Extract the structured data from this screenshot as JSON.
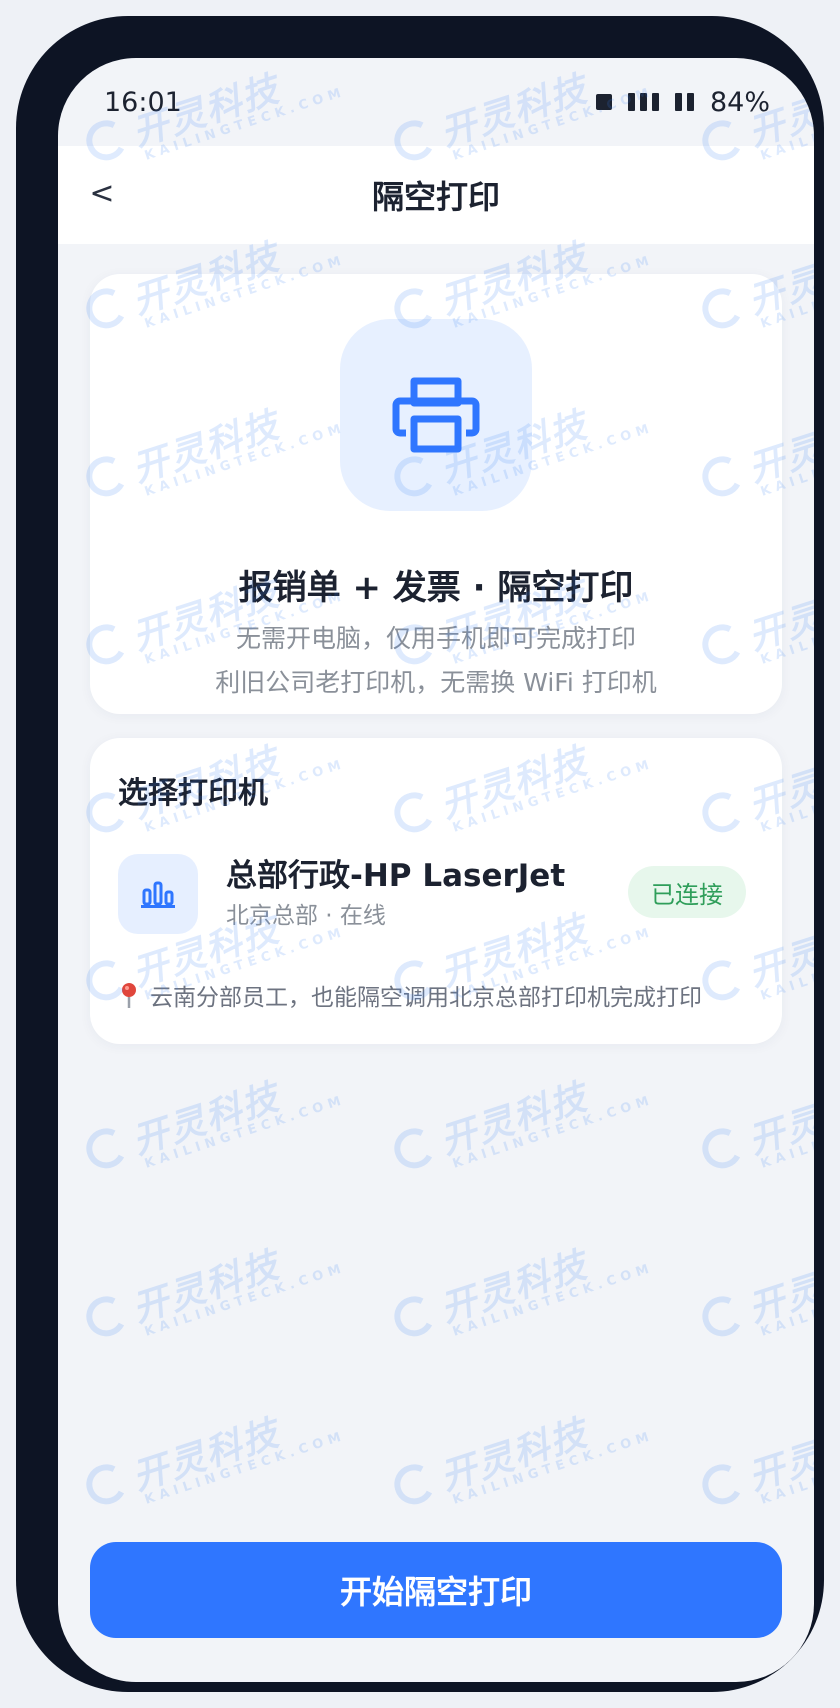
{
  "status_bar": {
    "time": "16:01",
    "battery": "84%"
  },
  "nav": {
    "back_label": "<",
    "title": "隔空打印"
  },
  "hero": {
    "icon": "printer-icon",
    "title": "报销单 + 发票 · 隔空打印",
    "subtitle_1": "无需开电脑，仅用手机即可完成打印",
    "subtitle_2": "利旧公司老打印机，无需换 WiFi 打印机"
  },
  "printer_section": {
    "title": "选择打印机",
    "printer": {
      "icon": "bar-chart-icon",
      "name": "总部行政-HP LaserJet",
      "meta": "北京总部 · 在线",
      "status": "已连接"
    },
    "note_icon": "pin-icon",
    "note": "云南分部员工，也能隔空调用北京总部打印机完成打印"
  },
  "actions": {
    "start_label": "开始隔空打印"
  },
  "watermark": {
    "text_cn": "开灵科技",
    "text_en": "KAILINGTECK.COM"
  },
  "colors": {
    "accent": "#2f76ff",
    "status_green": "#2f9e5a",
    "frame": "#0d1424"
  }
}
